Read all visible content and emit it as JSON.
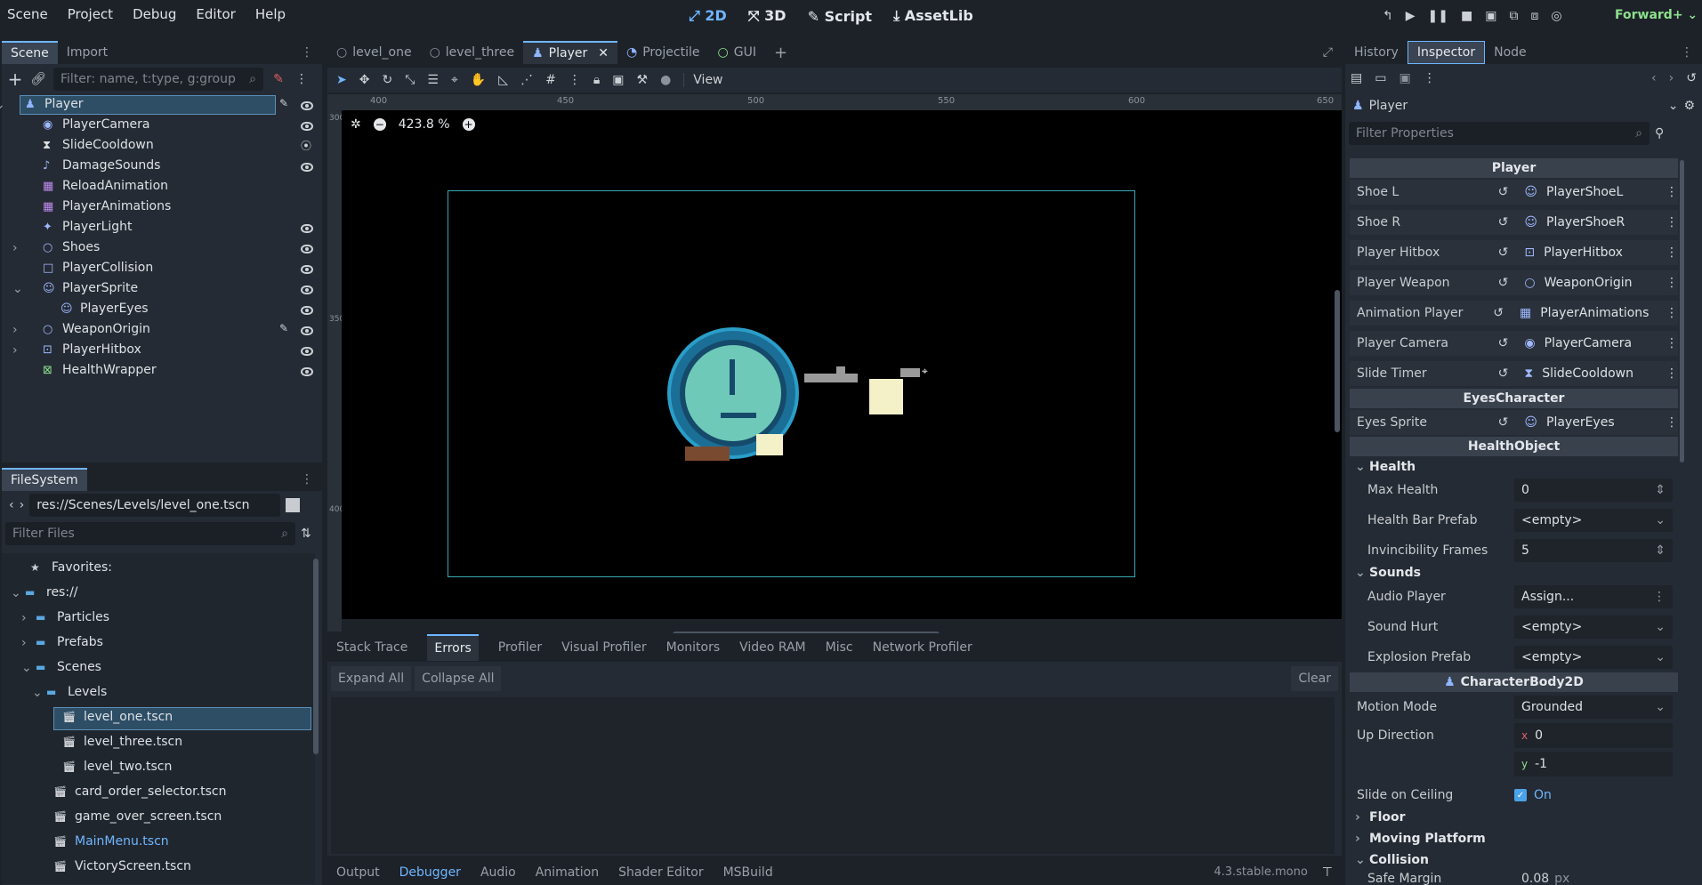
{
  "menu": [
    "Scene",
    "Project",
    "Debug",
    "Editor",
    "Help"
  ],
  "workspaces": [
    {
      "label": "2D",
      "active": true
    },
    {
      "label": "3D",
      "active": false
    },
    {
      "label": "Script",
      "active": false
    },
    {
      "label": "AssetLib",
      "active": false
    }
  ],
  "renderer": "Forward+",
  "scene_dock": {
    "tabs": [
      "Scene",
      "Import"
    ],
    "filter_placeholder": "Filter: name, t:type, g:group",
    "nodes": [
      {
        "name": "Player",
        "icon": "character-icon",
        "color": "#8fb6ff"
      },
      {
        "name": "PlayerCamera",
        "icon": "camera-icon",
        "color": "#9fb8ff"
      },
      {
        "name": "SlideCooldown",
        "icon": "timer-icon",
        "color": "#e0e0e0"
      },
      {
        "name": "DamageSounds",
        "icon": "audio-icon",
        "color": "#9fb8ff"
      },
      {
        "name": "ReloadAnimation",
        "icon": "animation-icon",
        "color": "#c08cf0"
      },
      {
        "name": "PlayerAnimations",
        "icon": "animation-icon",
        "color": "#c08cf0"
      },
      {
        "name": "PlayerLight",
        "icon": "light-icon",
        "color": "#9fb8ff"
      },
      {
        "name": "Shoes",
        "icon": "node2d-icon",
        "color": "#9fb8ff"
      },
      {
        "name": "PlayerCollision",
        "icon": "collision-shape-icon",
        "color": "#9fb8ff"
      },
      {
        "name": "PlayerSprite",
        "icon": "sprite-icon",
        "color": "#9fb8ff"
      },
      {
        "name": "PlayerEyes",
        "icon": "sprite-icon",
        "color": "#9fb8ff"
      },
      {
        "name": "WeaponOrigin",
        "icon": "node2d-icon",
        "color": "#9fb8ff"
      },
      {
        "name": "PlayerHitbox",
        "icon": "area-icon",
        "color": "#9fb8ff"
      },
      {
        "name": "HealthWrapper",
        "icon": "health-icon",
        "color": "#8de08d"
      }
    ]
  },
  "filesystem": {
    "title": "FileSystem",
    "path": "res://Scenes/Levels/level_one.tscn",
    "filter_placeholder": "Filter Files",
    "items": [
      {
        "label": "Favorites:",
        "icon": "star-icon"
      },
      {
        "label": "res://",
        "icon": "folder-icon"
      },
      {
        "label": "Particles",
        "icon": "folder-icon"
      },
      {
        "label": "Prefabs",
        "icon": "folder-icon"
      },
      {
        "label": "Scenes",
        "icon": "folder-icon"
      },
      {
        "label": "Levels",
        "icon": "folder-icon"
      },
      {
        "label": "level_one.tscn",
        "icon": "scene-file-icon"
      },
      {
        "label": "level_three.tscn",
        "icon": "scene-file-icon"
      },
      {
        "label": "level_two.tscn",
        "icon": "scene-file-icon"
      },
      {
        "label": "card_order_selector.tscn",
        "icon": "scene-file-icon"
      },
      {
        "label": "game_over_screen.tscn",
        "icon": "scene-file-icon"
      },
      {
        "label": "MainMenu.tscn",
        "icon": "scene-file-icon"
      },
      {
        "label": "VictoryScreen.tscn",
        "icon": "scene-file-icon"
      }
    ]
  },
  "editor_tabs": [
    "level_one",
    "level_three",
    "Player",
    "Projectile",
    "GUI"
  ],
  "viewport": {
    "zoom": "423.8 %",
    "view_label": "View",
    "ruler_top": [
      "400",
      "450",
      "500",
      "550",
      "600",
      "650"
    ],
    "ruler_left": [
      "300",
      "350",
      "400"
    ]
  },
  "debugger": {
    "tabs": [
      "Stack Trace",
      "Errors",
      "Profiler",
      "Visual Profiler",
      "Monitors",
      "Video RAM",
      "Misc",
      "Network Profiler"
    ],
    "expand_all": "Expand All",
    "collapse_all": "Collapse All",
    "clear": "Clear"
  },
  "bottom_tabs": [
    "Output",
    "Debugger",
    "Audio",
    "Animation",
    "Shader Editor",
    "MSBuild"
  ],
  "version": "4.3.stable.mono",
  "inspector": {
    "tabs": [
      "History",
      "Inspector",
      "Node"
    ],
    "object": "Player",
    "filter_placeholder": "Filter Properties",
    "sections": {
      "player": "Player",
      "eyes": "EyesCharacter",
      "health_obj": "HealthObject",
      "body": "CharacterBody2D"
    },
    "player_props": [
      {
        "label": "Shoe L",
        "value": "PlayerShoeL",
        "icon": "sprite-icon"
      },
      {
        "label": "Shoe R",
        "value": "PlayerShoeR",
        "icon": "sprite-icon"
      },
      {
        "label": "Player Hitbox",
        "value": "PlayerHitbox",
        "icon": "area-icon"
      },
      {
        "label": "Player Weapon",
        "value": "WeaponOrigin",
        "icon": "node2d-icon"
      },
      {
        "label": "Animation Player",
        "value": "PlayerAnimations",
        "icon": "animation-icon"
      },
      {
        "label": "Player Camera",
        "value": "PlayerCamera",
        "icon": "camera-icon"
      },
      {
        "label": "Slide Timer",
        "value": "SlideCooldown",
        "icon": "timer-icon"
      }
    ],
    "eyes_props": [
      {
        "label": "Eyes Sprite",
        "value": "PlayerEyes",
        "icon": "sprite-icon"
      }
    ],
    "health_group": "Health",
    "max_health_label": "Max Health",
    "max_health": "0",
    "health_bar_label": "Health Bar Prefab",
    "health_bar": "<empty>",
    "invincibility_label": "Invincibility Frames",
    "invincibility": "5",
    "sounds_group": "Sounds",
    "audio_player_label": "Audio Player",
    "audio_player": "Assign...",
    "sound_hurt_label": "Sound Hurt",
    "sound_hurt": "<empty>",
    "explosion_label": "Explosion Prefab",
    "explosion": "<empty>",
    "motion_mode_label": "Motion Mode",
    "motion_mode": "Grounded",
    "up_direction_label": "Up Direction",
    "up_x": "0",
    "up_y": "-1",
    "slide_ceiling_label": "Slide on Ceiling",
    "slide_ceiling": "On",
    "floor": "Floor",
    "moving_platform": "Moving Platform",
    "collision": "Collision",
    "safe_margin_label": "Safe Margin",
    "safe_margin": "0.08",
    "safe_margin_unit": "px"
  }
}
